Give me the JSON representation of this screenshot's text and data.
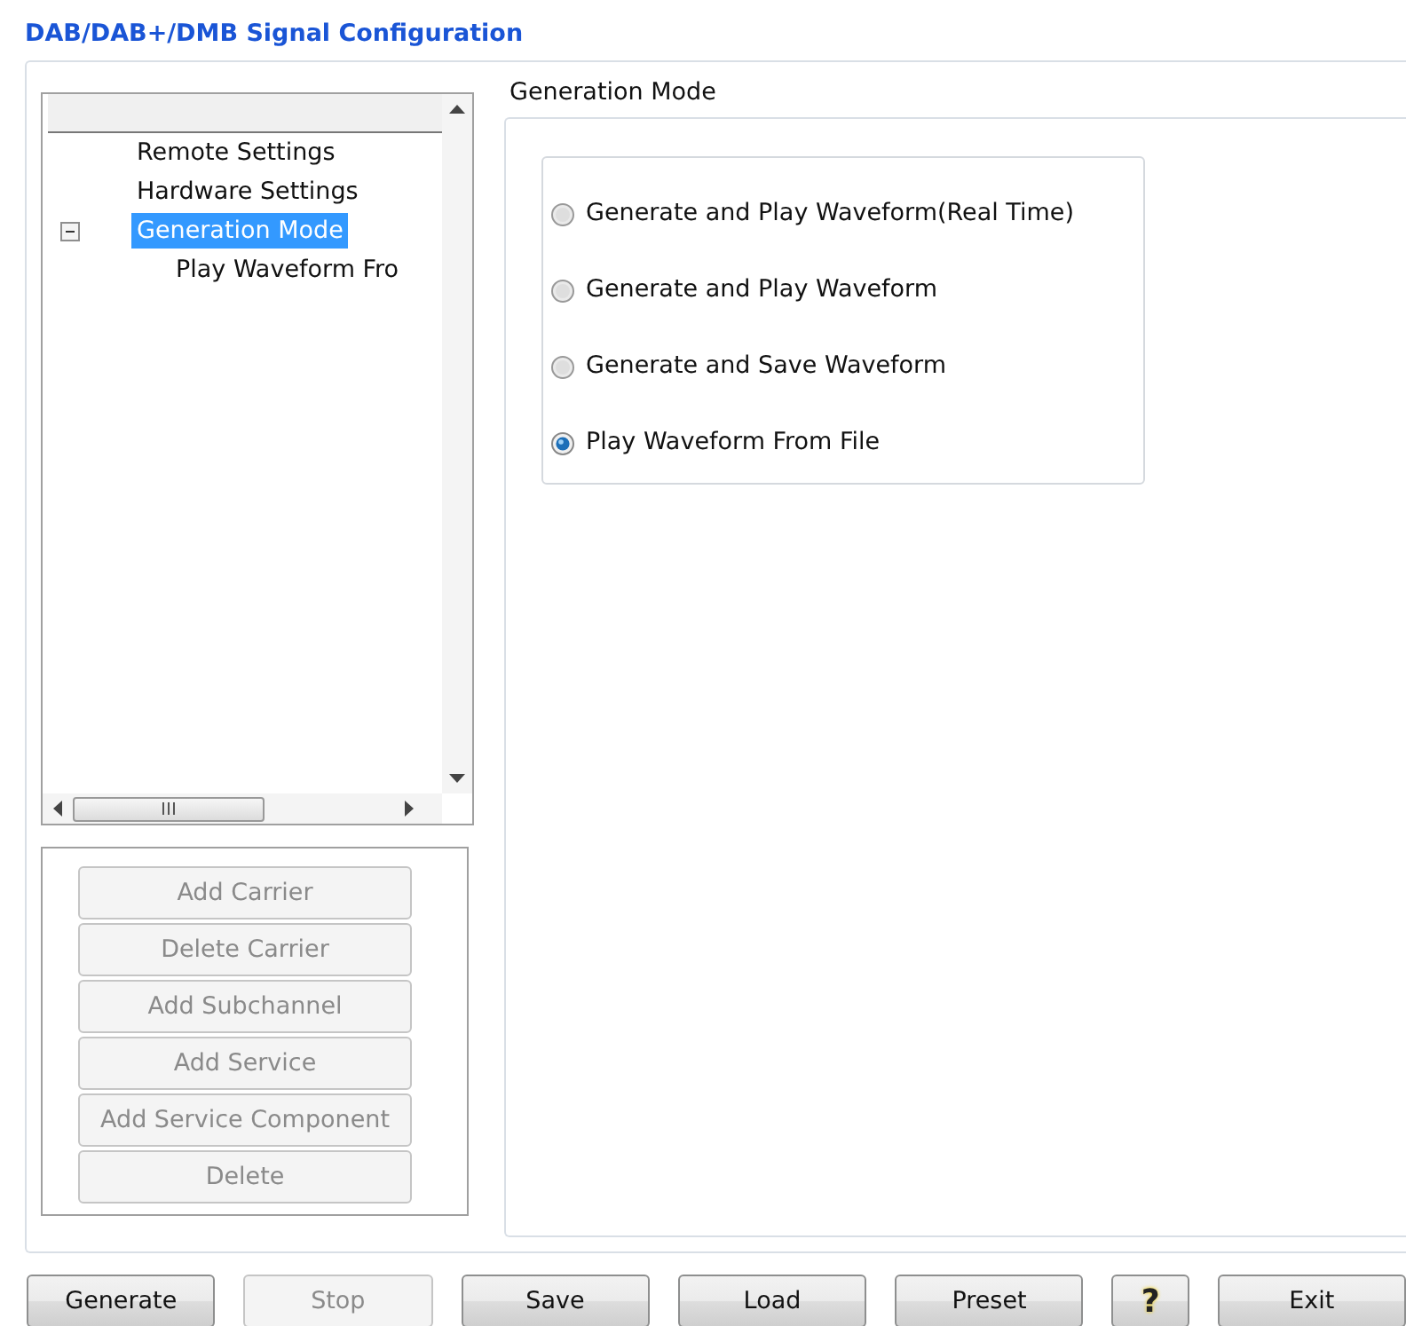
{
  "window": {
    "title": "DAB/DAB+/DMB Signal Configuration"
  },
  "tree": {
    "items": [
      {
        "label": "Remote Settings",
        "selected": false
      },
      {
        "label": "Hardware Settings",
        "selected": false
      },
      {
        "label": "Generation Mode",
        "selected": true,
        "expanded": true,
        "children": [
          {
            "label": "Play Waveform Fro",
            "selected": false
          }
        ]
      }
    ]
  },
  "side_buttons": [
    {
      "label": "Add Carrier",
      "disabled": true
    },
    {
      "label": "Delete Carrier",
      "disabled": true
    },
    {
      "label": "Add Subchannel",
      "disabled": true
    },
    {
      "label": "Add Service",
      "disabled": true
    },
    {
      "label": "Add Service Component",
      "disabled": true
    },
    {
      "label": "Delete",
      "disabled": true
    }
  ],
  "panel": {
    "title": "Generation Mode",
    "options": [
      {
        "label": "Generate and Play Waveform(Real Time)",
        "selected": false
      },
      {
        "label": "Generate and Play Waveform",
        "selected": false
      },
      {
        "label": "Generate and Save Waveform",
        "selected": false
      },
      {
        "label": "Play Waveform From File",
        "selected": true
      }
    ]
  },
  "buttons": [
    {
      "label": "Generate",
      "disabled": false,
      "kind": "text"
    },
    {
      "label": "Stop",
      "disabled": true,
      "kind": "text"
    },
    {
      "label": "Save",
      "disabled": false,
      "kind": "text"
    },
    {
      "label": "Load",
      "disabled": false,
      "kind": "text"
    },
    {
      "label": "Preset",
      "disabled": false,
      "kind": "text"
    },
    {
      "label": "?",
      "disabled": false,
      "kind": "help"
    },
    {
      "label": "Exit",
      "disabled": false,
      "kind": "text"
    }
  ]
}
